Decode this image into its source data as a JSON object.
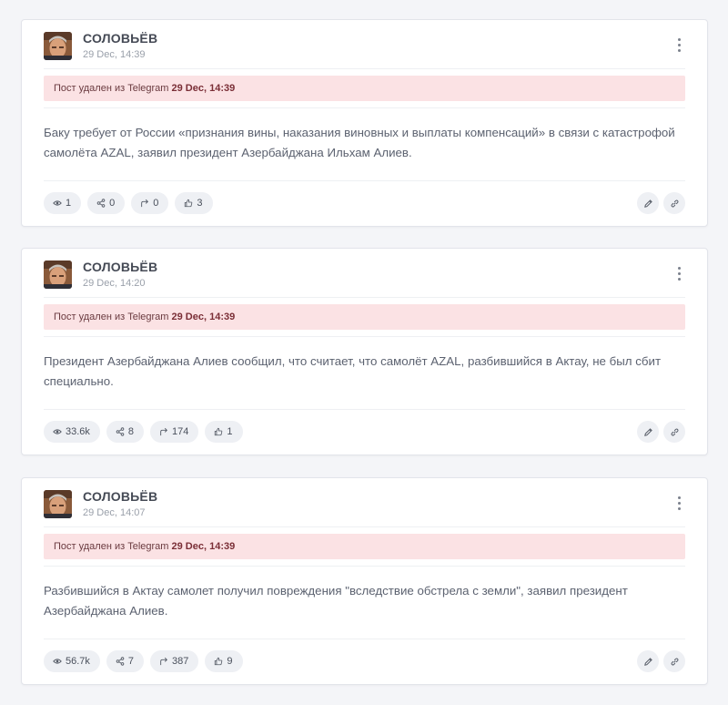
{
  "posts": [
    {
      "author": "СОЛОВЬЁВ",
      "date": "29 Dec, 14:39",
      "deleted_prefix": "Пост удален из Telegram",
      "deleted_time": "29 Dec, 14:39",
      "text": "Баку требует от России «признания вины, наказания виновных и выплаты компенсаций» в связи с катастрофой самолёта AZAL, заявил президент Азербайджана Ильхам Алиев.",
      "views": "1",
      "shares": "0",
      "forwards": "0",
      "reactions": "3"
    },
    {
      "author": "СОЛОВЬЁВ",
      "date": "29 Dec, 14:20",
      "deleted_prefix": "Пост удален из Telegram",
      "deleted_time": "29 Dec, 14:39",
      "text": "Президент Азербайджана Алиев сообщил, что считает, что самолёт AZAL, разбившийся в Актау, не был сбит специально.",
      "views": "33.6k",
      "shares": "8",
      "forwards": "174",
      "reactions": "1"
    },
    {
      "author": "СОЛОВЬЁВ",
      "date": "29 Dec, 14:07",
      "deleted_prefix": "Пост удален из Telegram",
      "deleted_time": "29 Dec, 14:39",
      "text": "Разбившийся в Актау самолет получил повреждения \"вследствие обстрела с земли\", заявил президент Азербайджана Алиев.",
      "views": "56.7k",
      "shares": "7",
      "forwards": "387",
      "reactions": "9"
    }
  ],
  "icons": {
    "views": "eye-icon",
    "shares": "share-icon",
    "forwards": "forward-icon",
    "reactions": "thumbs-up-icon",
    "edit": "pencil-icon",
    "link": "link-icon",
    "menu": "more-vertical-icon"
  },
  "colors": {
    "banner_bg": "#fbe2e4",
    "pill_bg": "#eef0f4",
    "page_bg": "#f4f5f8"
  }
}
